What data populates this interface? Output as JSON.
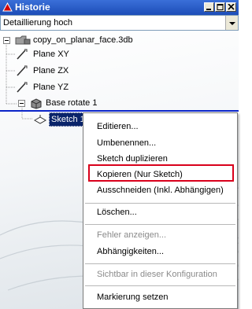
{
  "window": {
    "title": "Historie",
    "brand_color": "#d20000"
  },
  "view_selector": {
    "value": "Detaillierung hoch"
  },
  "tree": {
    "nodes": [
      {
        "label": "copy_on_planar_face.3db",
        "icon": "assembly-folder-icon"
      },
      {
        "label": "Plane XY",
        "icon": "plane-icon"
      },
      {
        "label": "Plane ZX",
        "icon": "plane-icon"
      },
      {
        "label": "Plane YZ",
        "icon": "plane-icon"
      },
      {
        "label": "Base rotate 1",
        "icon": "solid-body-icon"
      },
      {
        "label": "Sketch 1",
        "icon": "sketch-icon"
      }
    ]
  },
  "context_menu": {
    "items": [
      {
        "label": "Editieren...",
        "enabled": true
      },
      {
        "label": "Umbenennen...",
        "enabled": true
      },
      {
        "label": "Sketch duplizieren",
        "enabled": true
      },
      {
        "label": "Kopieren (Nur Sketch)",
        "enabled": true,
        "highlighted": true
      },
      {
        "label": "Ausschneiden (Inkl. Abhängigen)",
        "enabled": true
      },
      {
        "label": "Löschen...",
        "enabled": true
      },
      {
        "label": "Fehler anzeigen...",
        "enabled": false
      },
      {
        "label": "Abhängigkeiten...",
        "enabled": true
      },
      {
        "label": "Sichtbar in dieser Konfiguration",
        "enabled": false
      },
      {
        "label": "Markierung setzen",
        "enabled": true
      }
    ],
    "highlight_color": "#d9001b"
  }
}
